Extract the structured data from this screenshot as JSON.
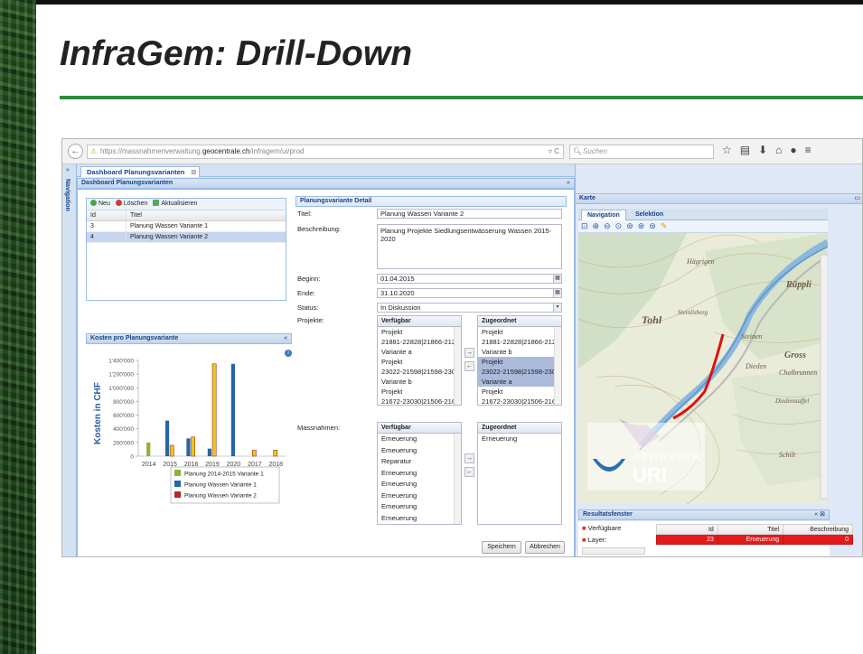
{
  "slide": {
    "title": "InfraGem: Drill-Down"
  },
  "browser": {
    "url_prefix": "https://massnahmenverwaltung.",
    "url_domain": "geocentrale.ch",
    "url_path": "/infragem/ui/prod",
    "search_placeholder": "Suchen"
  },
  "app": {
    "nav_label": "Navigation",
    "tab_label": "Dashboard Planungsvarianten",
    "dashboard_header": "Dashboard Planungsvarianten",
    "grid": {
      "toolbar": {
        "new": "Neu",
        "delete": "Löschen",
        "refresh": "Aktualisieren"
      },
      "columns": [
        "Id",
        "Titel"
      ],
      "rows": [
        {
          "id": "3",
          "title": "Planung Wassen Variante 1"
        },
        {
          "id": "4",
          "title": "Planung Wassen Variante 2"
        }
      ]
    },
    "chart_header": "Kosten pro Planungsvariante",
    "detail": {
      "header": "Planungsvariante Detail",
      "title_label": "Titel:",
      "title_value": "Planung Wassen Variante 2",
      "desc_label": "Beschreibung:",
      "desc_value": "Planung Projekte Siedlungsentwässerung Wassen 2015-2020",
      "begin_label": "Beginn:",
      "begin_value": "01.04.2015",
      "end_label": "Ende:",
      "end_value": "31.10.2020",
      "status_label": "Status:",
      "status_value": "In Diskussion",
      "projects_label": "Projekte:",
      "measures_label": "Massnahmen:",
      "available_label": "Verfügbar",
      "assigned_label": "Zugeordnet",
      "projects_available": [
        "Projekt",
        "21881-22828|21866-2128",
        "Variante a",
        "Projekt",
        "23022-21598|21598-230",
        "Variante b",
        "Projekt",
        "21672-23030|21506-216"
      ],
      "projects_assigned": [
        "Projekt",
        "21881-22828|21866-2128",
        "Variante b",
        "Projekt",
        "23022-21598|21598-230",
        "Variante a",
        "Projekt",
        "21672-23030|21506-216"
      ],
      "measures_available": [
        "Erneuerung",
        "Erneuerung",
        "Reparatur",
        "Erneuerung",
        "Erneuerung",
        "Erneuerung",
        "Erneuerung",
        "Erneuerung"
      ],
      "measures_assigned": [
        "Erneuerung"
      ],
      "save_label": "Speichern",
      "cancel_label": "Abbrechen"
    },
    "map": {
      "header": "Karte",
      "tab_navigation": "Navigation",
      "tab_selection": "Selektion",
      "place_names": [
        "Hägrigen",
        "Rüppli",
        "Gross",
        "Steinen",
        "Dieden",
        "Cholbrunnen",
        "Diedenstaffel",
        "Schilt",
        "Tohl",
        "Steinlisberg"
      ],
      "logo_top": "ABWASSER",
      "logo_bottom": "URI",
      "result_header": "Resultatsfenster",
      "result_rows": [
        "Verfügbare",
        "Layer:"
      ],
      "result_columns": [
        "Id",
        "Titel",
        "Beschreibung"
      ],
      "result_cells": [
        "23",
        "Erneuerung",
        "0"
      ]
    }
  },
  "chart_data": {
    "type": "bar",
    "title": "Kosten pro Planungsvariante",
    "ylabel": "Kosten in CHF",
    "xlabel": "",
    "categories": [
      "2014",
      "2015",
      "2016",
      "2019",
      "2020",
      "2017",
      "2018"
    ],
    "y_ticks": [
      "0",
      "200'000",
      "400'000",
      "600'000",
      "800'000",
      "1'000'000",
      "1'200'000",
      "1'400'000"
    ],
    "ylim": [
      0,
      1400000
    ],
    "series": [
      {
        "name": "Planung 2014-2015 Variante 1",
        "color": "#8db33a",
        "values": [
          200000,
          0,
          0,
          0,
          0,
          0,
          0
        ]
      },
      {
        "name": "Planung Wassen Variante 1",
        "color": "#2665a8",
        "values": [
          0,
          520000,
          260000,
          110000,
          1350000,
          0,
          0
        ]
      },
      {
        "name": "Planung Wassen Variante 2",
        "color": "#f0c419",
        "values": [
          0,
          160000,
          280000,
          1350000,
          0,
          90000,
          90000
        ]
      }
    ],
    "legend_position": "bottom",
    "grid": false
  }
}
